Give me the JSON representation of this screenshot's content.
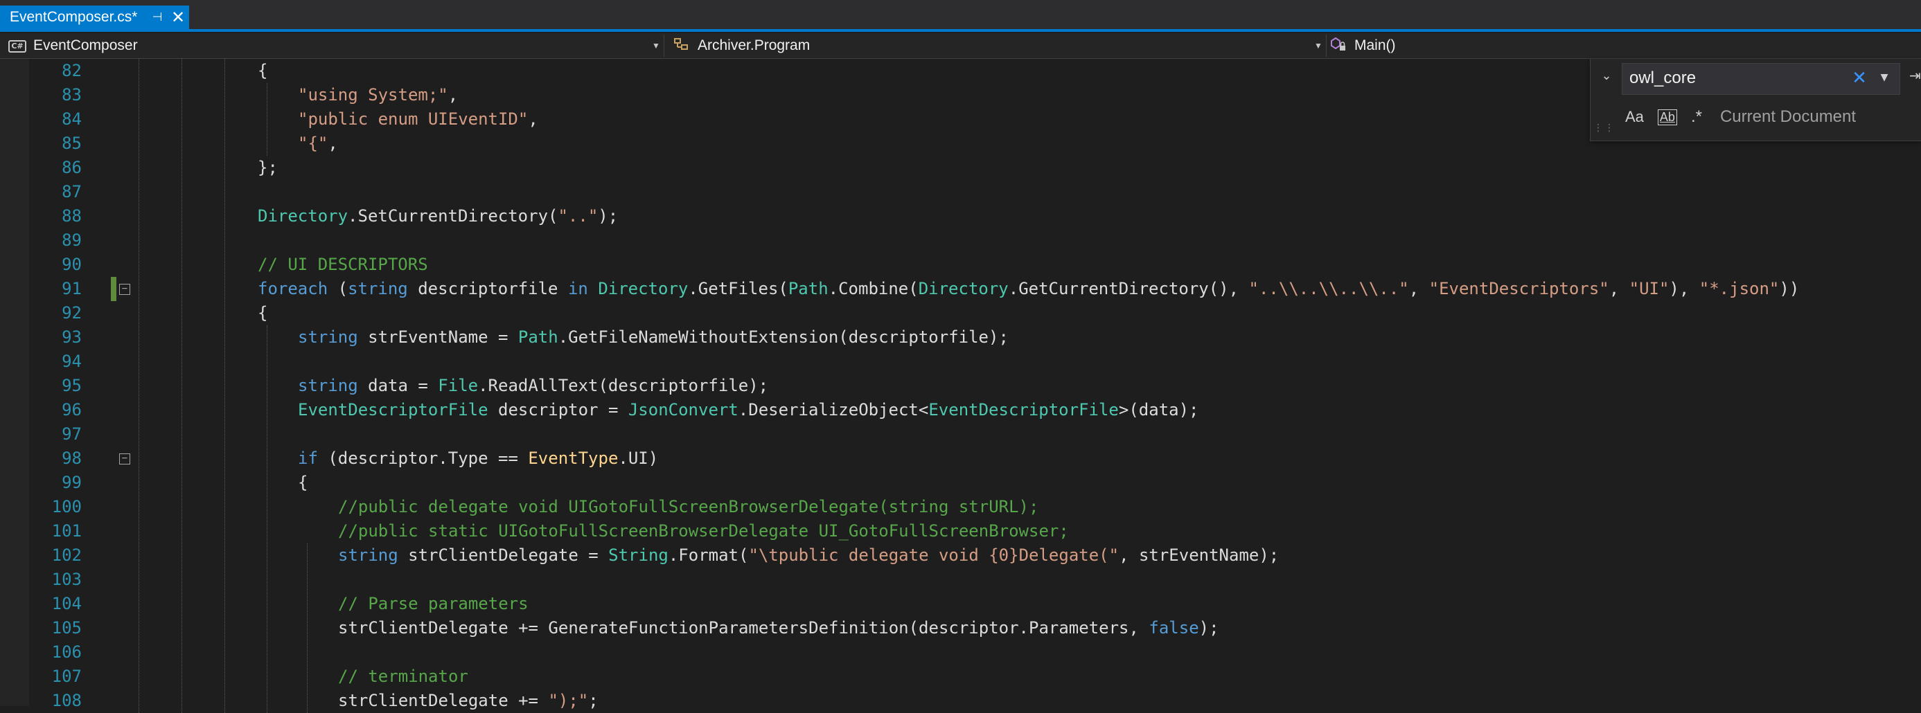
{
  "tab": {
    "title": "EventComposer.cs*",
    "pin_icon": "pin-icon",
    "close_icon": "close-icon"
  },
  "navbar": {
    "project": "EventComposer",
    "project_badge": "C#",
    "type": "Archiver.Program",
    "member": "Main()"
  },
  "find": {
    "query": "owl_core",
    "match_case_label": "Aa",
    "whole_word_label": "Ab",
    "regex_label": ".*",
    "scope": "Current Document"
  },
  "editor": {
    "lines": [
      {
        "n": "82",
        "indent": 0,
        "tokens": [
          [
            "p",
            "{"
          ]
        ]
      },
      {
        "n": "83",
        "indent": 1,
        "tokens": [
          [
            "s",
            "\"using System;\""
          ],
          [
            "p",
            ","
          ]
        ]
      },
      {
        "n": "84",
        "indent": 1,
        "tokens": [
          [
            "s",
            "\"public enum UIEventID\""
          ],
          [
            "p",
            ","
          ]
        ]
      },
      {
        "n": "85",
        "indent": 1,
        "tokens": [
          [
            "s",
            "\"{\""
          ],
          [
            "p",
            ","
          ]
        ]
      },
      {
        "n": "86",
        "indent": 0,
        "tokens": [
          [
            "p",
            "};"
          ]
        ]
      },
      {
        "n": "87",
        "indent": 0,
        "tokens": []
      },
      {
        "n": "88",
        "indent": 0,
        "tokens": [
          [
            "t",
            "Directory"
          ],
          [
            "p",
            ".SetCurrentDirectory("
          ],
          [
            "s",
            "\"..\""
          ],
          [
            "p",
            ");"
          ]
        ]
      },
      {
        "n": "89",
        "indent": 0,
        "tokens": []
      },
      {
        "n": "90",
        "indent": 0,
        "tokens": [
          [
            "c",
            "// UI DESCRIPTORS"
          ]
        ]
      },
      {
        "n": "91",
        "indent": 0,
        "fold": true,
        "changed": true,
        "tokens": [
          [
            "k",
            "foreach"
          ],
          [
            "p",
            " ("
          ],
          [
            "k",
            "string"
          ],
          [
            "p",
            " descriptorfile "
          ],
          [
            "k",
            "in"
          ],
          [
            "p",
            " "
          ],
          [
            "t",
            "Directory"
          ],
          [
            "p",
            ".GetFiles("
          ],
          [
            "t",
            "Path"
          ],
          [
            "p",
            ".Combine("
          ],
          [
            "t",
            "Directory"
          ],
          [
            "p",
            ".GetCurrentDirectory(), "
          ],
          [
            "s",
            "\"..\\\\..\\\\..\\\\..\""
          ],
          [
            "p",
            ", "
          ],
          [
            "s",
            "\"EventDescriptors\""
          ],
          [
            "p",
            ", "
          ],
          [
            "s",
            "\"UI\""
          ],
          [
            "p",
            "), "
          ],
          [
            "s",
            "\"*.json\""
          ],
          [
            "p",
            "))"
          ]
        ]
      },
      {
        "n": "92",
        "indent": 0,
        "tokens": [
          [
            "p",
            "{"
          ]
        ]
      },
      {
        "n": "93",
        "indent": 1,
        "tokens": [
          [
            "k",
            "string"
          ],
          [
            "p",
            " strEventName = "
          ],
          [
            "t",
            "Path"
          ],
          [
            "p",
            ".GetFileNameWithoutExtension(descriptorfile);"
          ]
        ]
      },
      {
        "n": "94",
        "indent": 1,
        "tokens": []
      },
      {
        "n": "95",
        "indent": 1,
        "tokens": [
          [
            "k",
            "string"
          ],
          [
            "p",
            " data = "
          ],
          [
            "t",
            "File"
          ],
          [
            "p",
            ".ReadAllText(descriptorfile);"
          ]
        ]
      },
      {
        "n": "96",
        "indent": 1,
        "tokens": [
          [
            "t",
            "EventDescriptorFile"
          ],
          [
            "p",
            " descriptor = "
          ],
          [
            "t",
            "JsonConvert"
          ],
          [
            "p",
            ".DeserializeObject<"
          ],
          [
            "t",
            "EventDescriptorFile"
          ],
          [
            "p",
            ">(data);"
          ]
        ]
      },
      {
        "n": "97",
        "indent": 1,
        "tokens": []
      },
      {
        "n": "98",
        "indent": 1,
        "fold": true,
        "tokens": [
          [
            "k",
            "if"
          ],
          [
            "p",
            " (descriptor.Type == "
          ],
          [
            "e",
            "EventType"
          ],
          [
            "p",
            ".UI)"
          ]
        ]
      },
      {
        "n": "99",
        "indent": 1,
        "tokens": [
          [
            "p",
            "{"
          ]
        ]
      },
      {
        "n": "100",
        "indent": 2,
        "tokens": [
          [
            "c",
            "//public delegate void UIGotoFullScreenBrowserDelegate(string strURL);"
          ]
        ]
      },
      {
        "n": "101",
        "indent": 2,
        "tokens": [
          [
            "c",
            "//public static UIGotoFullScreenBrowserDelegate UI_GotoFullScreenBrowser;"
          ]
        ]
      },
      {
        "n": "102",
        "indent": 2,
        "tokens": [
          [
            "k",
            "string"
          ],
          [
            "p",
            " strClientDelegate = "
          ],
          [
            "t",
            "String"
          ],
          [
            "p",
            ".Format("
          ],
          [
            "s",
            "\"\\tpublic delegate void {0}Delegate(\""
          ],
          [
            "p",
            ", strEventName);"
          ]
        ]
      },
      {
        "n": "103",
        "indent": 2,
        "tokens": []
      },
      {
        "n": "104",
        "indent": 2,
        "tokens": [
          [
            "c",
            "// Parse parameters"
          ]
        ]
      },
      {
        "n": "105",
        "indent": 2,
        "tokens": [
          [
            "p",
            "strClientDelegate += GenerateFunctionParametersDefinition(descriptor.Parameters, "
          ],
          [
            "k",
            "false"
          ],
          [
            "p",
            ");"
          ]
        ]
      },
      {
        "n": "106",
        "indent": 2,
        "tokens": []
      },
      {
        "n": "107",
        "indent": 2,
        "tokens": [
          [
            "c",
            "// terminator"
          ]
        ]
      },
      {
        "n": "108",
        "indent": 2,
        "tokens": [
          [
            "p",
            "strClientDelegate += "
          ],
          [
            "s",
            "\");\""
          ],
          [
            "p",
            ";"
          ]
        ]
      }
    ]
  }
}
